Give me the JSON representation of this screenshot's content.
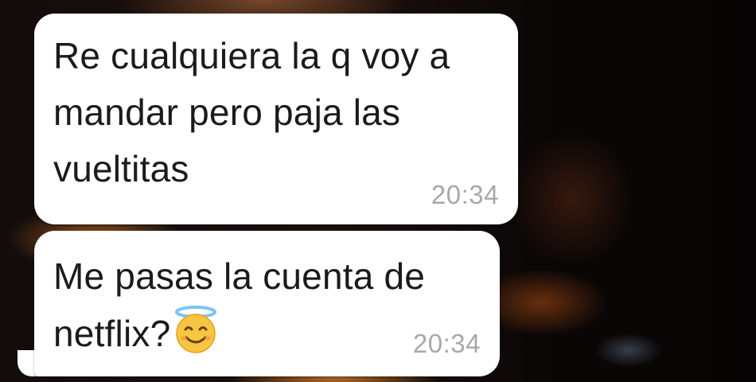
{
  "messages": [
    {
      "text": "Re cualquiera la q voy a mandar pero paja las vueltitas",
      "time": "20:34"
    },
    {
      "text": "Me pasas la cuenta de netflix?",
      "emoji": "smiling-face-with-halo",
      "time": "20:34"
    }
  ],
  "colors": {
    "bubble": "#ffffff",
    "text": "#1b1b1b",
    "timestamp": "#a8a8a8"
  }
}
